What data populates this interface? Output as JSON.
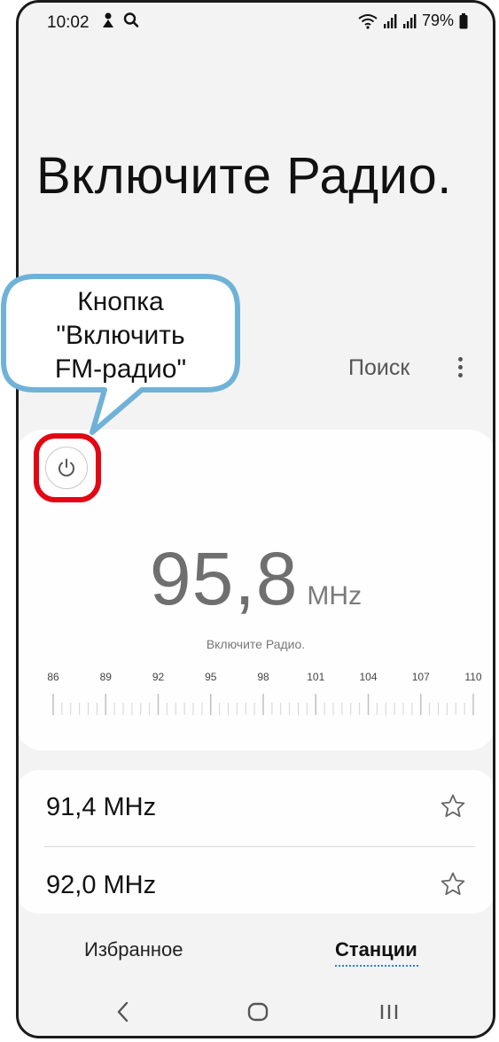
{
  "status_bar": {
    "time": "10:02",
    "battery": "79%"
  },
  "hero": {
    "title": "Включите Радио."
  },
  "toolbar": {
    "search_label": "Поиск",
    "more_icon": "more-vertical-icon"
  },
  "tuner": {
    "power_icon": "power-icon",
    "frequency": "95,8",
    "unit": "MHz",
    "hint": "Включите Радио.",
    "scale_labels": [
      "86",
      "89",
      "92",
      "95",
      "98",
      "101",
      "104",
      "107",
      "110"
    ]
  },
  "stations": [
    {
      "frequency": "91,4 MHz",
      "icon": "star-outline-icon"
    },
    {
      "frequency": "92,0 MHz",
      "icon": "star-outline-icon"
    }
  ],
  "tabs": {
    "favorites": "Избранное",
    "stations": "Станции",
    "active": "stations"
  },
  "callout": {
    "line1": "Кнопка",
    "line2": "\"Включить",
    "line3": "FM-радио\""
  },
  "colors": {
    "highlight": "#e30613",
    "callout_border": "#6fb2d8",
    "tab_underline": "#2c7ed6"
  }
}
